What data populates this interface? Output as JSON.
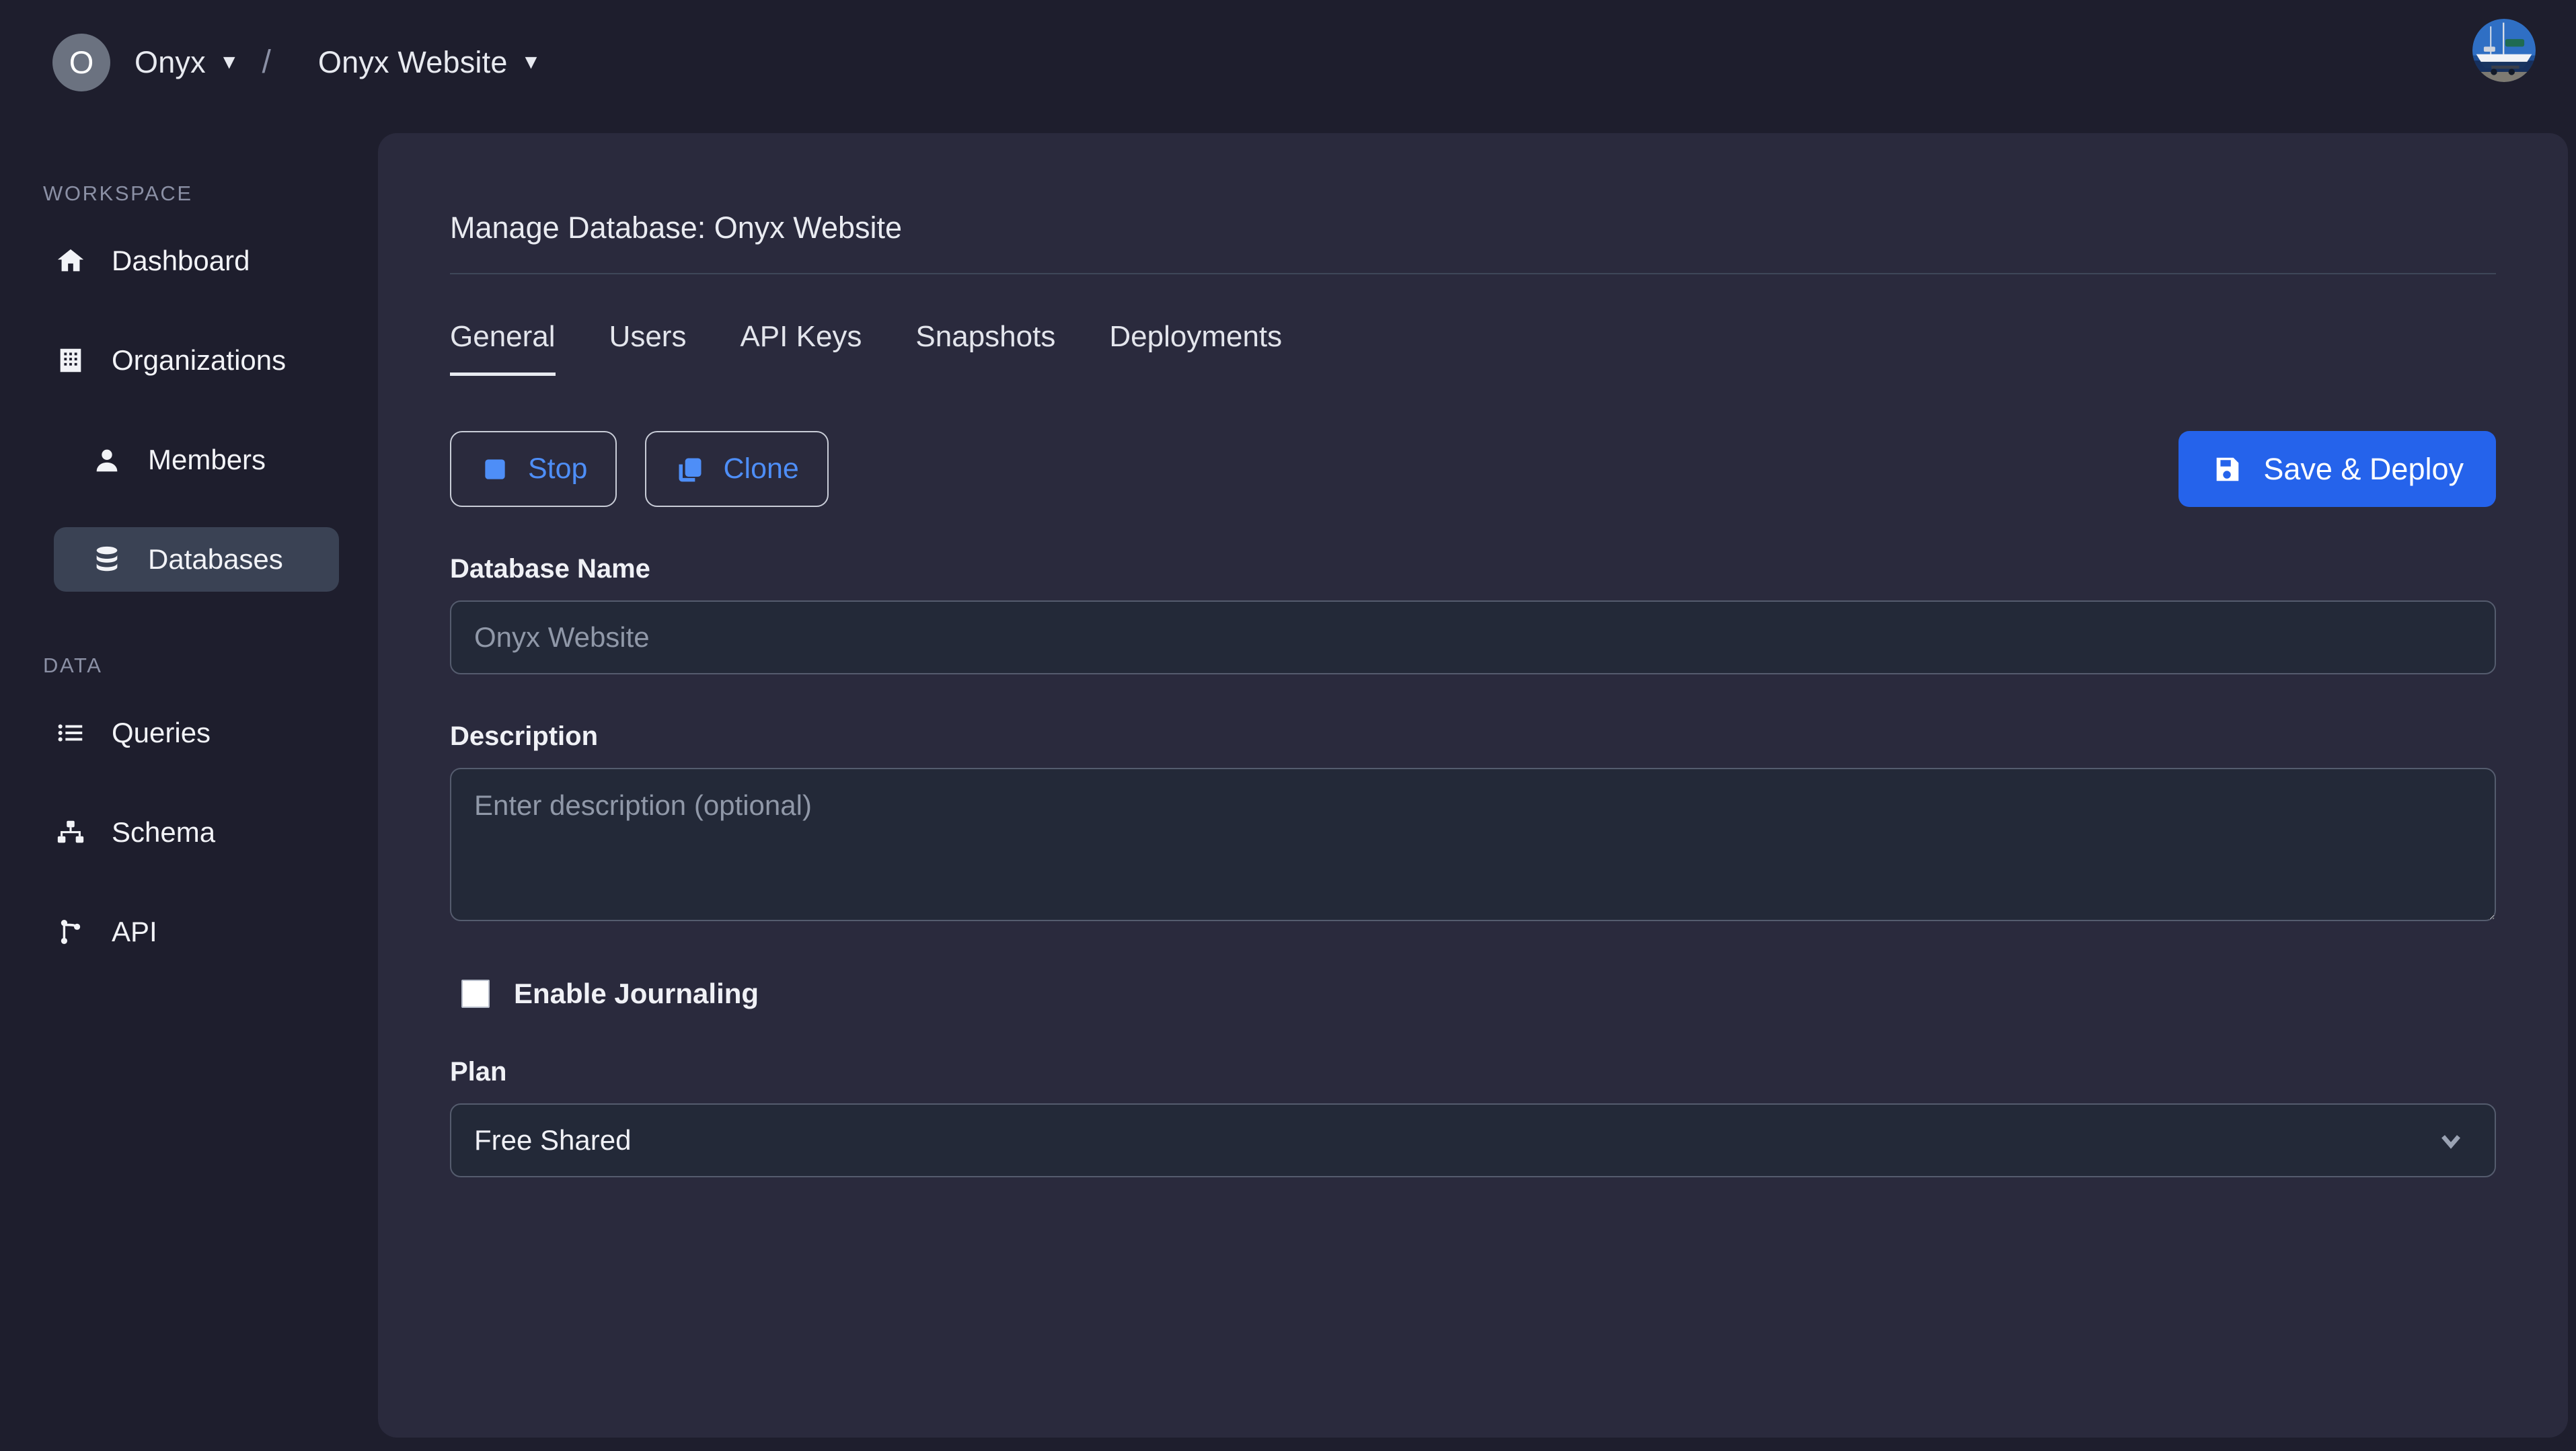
{
  "topbar": {
    "org_initial": "O",
    "org_name": "Onyx",
    "org_caret": "▼",
    "separator": "/",
    "project_name": "Onyx Website",
    "project_caret": "▼",
    "avatar_alt": "sailboat-photo"
  },
  "sidebar": {
    "sections": [
      {
        "title": "WORKSPACE",
        "items": [
          {
            "label": "Dashboard",
            "icon": "home-icon",
            "active": false,
            "indent": false
          },
          {
            "label": "Organizations",
            "icon": "building-icon",
            "active": false,
            "indent": false
          },
          {
            "label": "Members",
            "icon": "person-icon",
            "active": false,
            "indent": true
          },
          {
            "label": "Databases",
            "icon": "database-icon",
            "active": true,
            "indent": true
          }
        ]
      },
      {
        "title": "DATA",
        "items": [
          {
            "label": "Queries",
            "icon": "list-icon",
            "active": false,
            "indent": false
          },
          {
            "label": "Schema",
            "icon": "sitemap-icon",
            "active": false,
            "indent": false
          },
          {
            "label": "API",
            "icon": "branch-icon",
            "active": false,
            "indent": false
          }
        ]
      }
    ]
  },
  "main": {
    "title": "Manage Database: Onyx Website",
    "tabs": [
      {
        "label": "General",
        "active": true
      },
      {
        "label": "Users",
        "active": false
      },
      {
        "label": "API Keys",
        "active": false
      },
      {
        "label": "Snapshots",
        "active": false
      },
      {
        "label": "Deployments",
        "active": false
      }
    ],
    "actions": {
      "stop_label": "Stop",
      "stop_icon": "stop-square-icon",
      "clone_label": "Clone",
      "clone_icon": "copy-icon",
      "save_label": "Save & Deploy",
      "save_icon": "floppy-disk-icon"
    },
    "form": {
      "name_label": "Database Name",
      "name_value": "",
      "name_placeholder": "Onyx Website",
      "description_label": "Description",
      "description_value": "",
      "description_placeholder": "Enter description (optional)",
      "journaling_label": "Enable Journaling",
      "journaling_checked": false,
      "plan_label": "Plan",
      "plan_value": "Free Shared",
      "plan_caret_icon": "chevron-down-icon"
    }
  },
  "colors": {
    "page_bg": "#1e1e2d",
    "panel_bg": "#2a2a3d",
    "input_bg": "#232938",
    "accent_blue": "#2563eb",
    "link_blue": "#4e8ef7",
    "active_nav": "#3a4254"
  }
}
